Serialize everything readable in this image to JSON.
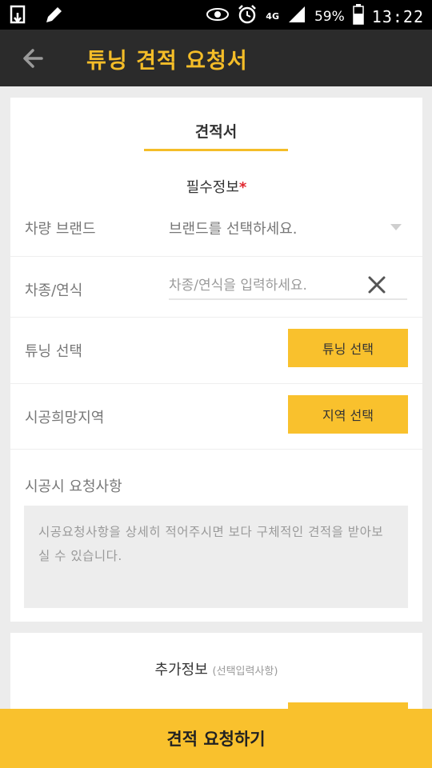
{
  "status_bar": {
    "network": "4G",
    "battery": "59%",
    "time": "13:22",
    "icons": [
      "download-screenshot-icon",
      "pen-icon",
      "eye-icon",
      "alarm-icon",
      "signal-icon",
      "battery-icon"
    ]
  },
  "header": {
    "title": "튜닝 견적 요청서",
    "back_icon": "arrow-left-icon"
  },
  "tab": {
    "label": "견적서"
  },
  "required": {
    "title": "필수정보",
    "star": "*"
  },
  "form": {
    "brand": {
      "label": "차량 브랜드",
      "placeholder": "브랜드를 선택하세요."
    },
    "model": {
      "label": "차종/연식",
      "placeholder": "차종/연식을 입력하세요."
    },
    "tuning": {
      "label": "튜닝 선택",
      "button": "튜닝 선택"
    },
    "region": {
      "label": "시공희망지역",
      "button": "지역 선택"
    },
    "request": {
      "label": "시공시 요청사항",
      "placeholder": "시공요청사항을 상세히 적어주시면 보다 구체적인 견적을 받아보실 수 있습니다."
    }
  },
  "extra": {
    "title": "추가정보",
    "subtitle": "(선택입력사항)"
  },
  "submit": {
    "label": "견적 요청하기"
  },
  "colors": {
    "accent": "#f9c12d",
    "appbar": "#2b2b2b",
    "title": "#f4bd28",
    "required_star": "#e0262e"
  }
}
